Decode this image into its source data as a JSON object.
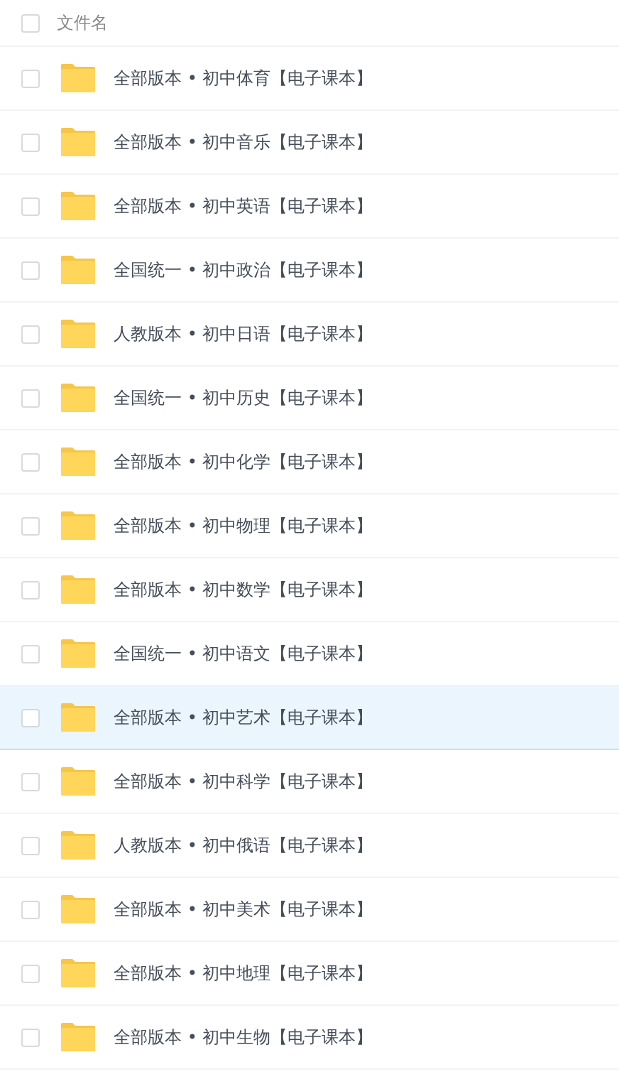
{
  "header": {
    "checked": false,
    "label": "文件名"
  },
  "rows": [
    {
      "name": "全部版本 • 初中体育【电子课本】",
      "checked": false,
      "highlighted": false
    },
    {
      "name": "全部版本 • 初中音乐【电子课本】",
      "checked": false,
      "highlighted": false
    },
    {
      "name": "全部版本 • 初中英语【电子课本】",
      "checked": false,
      "highlighted": false
    },
    {
      "name": "全国统一 • 初中政治【电子课本】",
      "checked": false,
      "highlighted": false
    },
    {
      "name": "人教版本 • 初中日语【电子课本】",
      "checked": false,
      "highlighted": false
    },
    {
      "name": "全国统一 • 初中历史【电子课本】",
      "checked": false,
      "highlighted": false
    },
    {
      "name": "全部版本 • 初中化学【电子课本】",
      "checked": false,
      "highlighted": false
    },
    {
      "name": "全部版本 • 初中物理【电子课本】",
      "checked": false,
      "highlighted": false
    },
    {
      "name": "全部版本 • 初中数学【电子课本】",
      "checked": false,
      "highlighted": false
    },
    {
      "name": "全国统一 • 初中语文【电子课本】",
      "checked": false,
      "highlighted": false
    },
    {
      "name": "全部版本 • 初中艺术【电子课本】",
      "checked": false,
      "highlighted": true
    },
    {
      "name": "全部版本 • 初中科学【电子课本】",
      "checked": false,
      "highlighted": false
    },
    {
      "name": "人教版本 • 初中俄语【电子课本】",
      "checked": false,
      "highlighted": false
    },
    {
      "name": "全部版本 • 初中美术【电子课本】",
      "checked": false,
      "highlighted": false
    },
    {
      "name": "全部版本 • 初中地理【电子课本】",
      "checked": false,
      "highlighted": false
    },
    {
      "name": "全部版本 • 初中生物【电子课本】",
      "checked": false,
      "highlighted": false
    }
  ]
}
